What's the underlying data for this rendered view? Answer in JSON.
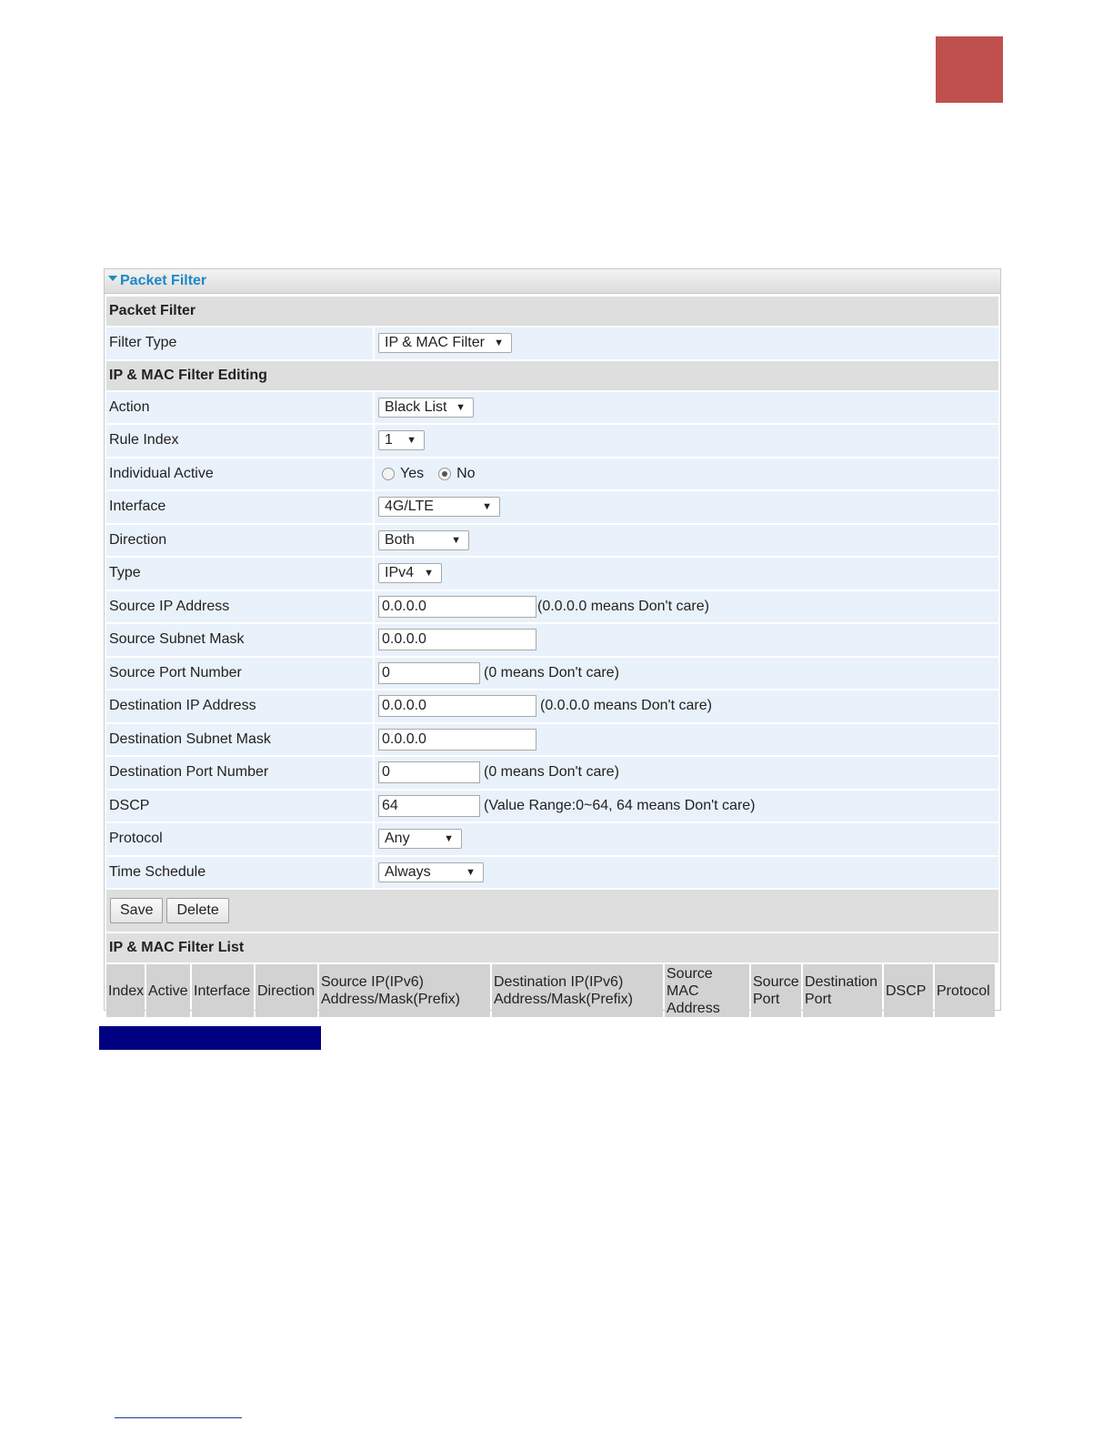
{
  "panel": {
    "title": "Packet Filter"
  },
  "sections": {
    "packet_filter": "Packet Filter",
    "editing": "IP & MAC Filter Editing",
    "list": "IP & MAC Filter List"
  },
  "fields": {
    "filter_type": {
      "label": "Filter Type",
      "value": "IP & MAC Filter"
    },
    "action": {
      "label": "Action",
      "value": "Black List"
    },
    "rule_index": {
      "label": "Rule Index",
      "value": "1"
    },
    "individual_active": {
      "label": "Individual Active",
      "yes": "Yes",
      "no": "No",
      "selected": "No"
    },
    "interface": {
      "label": "Interface",
      "value": "4G/LTE"
    },
    "direction": {
      "label": "Direction",
      "value": "Both"
    },
    "type": {
      "label": "Type",
      "value": "IPv4"
    },
    "source_ip": {
      "label": "Source IP Address",
      "value": "0.0.0.0",
      "note": "(0.0.0.0 means Don't care)"
    },
    "source_mask": {
      "label": "Source Subnet Mask",
      "value": "0.0.0.0"
    },
    "source_port": {
      "label": "Source Port Number",
      "value": "0",
      "note": "(0 means Don't care)"
    },
    "dest_ip": {
      "label": "Destination IP Address",
      "value": "0.0.0.0",
      "note": "(0.0.0.0 means Don't care)"
    },
    "dest_mask": {
      "label": "Destination Subnet Mask",
      "value": "0.0.0.0"
    },
    "dest_port": {
      "label": "Destination Port Number",
      "value": "0",
      "note": "(0 means Don't care)"
    },
    "dscp": {
      "label": "DSCP",
      "value": "64",
      "note": "(Value Range:0~64, 64 means Don't care)"
    },
    "protocol": {
      "label": "Protocol",
      "value": "Any"
    },
    "time_schedule": {
      "label": "Time Schedule",
      "value": "Always"
    }
  },
  "buttons": {
    "save": "Save",
    "delete": "Delete"
  },
  "table": {
    "headers": {
      "index": "Index",
      "active": "Active",
      "interface": "Interface",
      "direction": "Direction",
      "source_ip_1": "Source IP(IPv6)",
      "source_ip_2": "Address/Mask(Prefix)",
      "dest_ip_1": "Destination IP(IPv6)",
      "dest_ip_2": "Address/Mask(Prefix)",
      "mac_1": "Source",
      "mac_2": "MAC",
      "mac_3": "Address",
      "sport_1": "Source",
      "sport_2": "Port",
      "dport_1": "Destination",
      "dport_2": "Port",
      "dscp": "DSCP",
      "protocol": "Protocol"
    }
  },
  "colors": {
    "corner_tab": "#c0504d",
    "header_text": "#1e88c7",
    "row_bg": "#e9f1fb",
    "section_bg": "#dedede",
    "blue_bar": "#000080"
  }
}
